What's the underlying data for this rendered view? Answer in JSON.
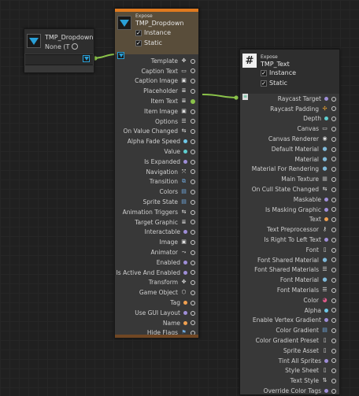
{
  "source_node": {
    "title": "TMP_Dropdown",
    "value": "None (T",
    "target_icon": "target-circle-icon"
  },
  "dropdown_node": {
    "expose_label": "Expose",
    "title": "TMP_Dropdown",
    "instance_label": "Instance",
    "static_label": "Static",
    "accent_color": "#e07a1f",
    "ports": [
      {
        "label": "Template",
        "icon": "move-icon"
      },
      {
        "label": "Caption Text",
        "icon": "text-box-icon"
      },
      {
        "label": "Caption Image",
        "icon": "image-icon"
      },
      {
        "label": "Placeholder",
        "icon": "script-icon"
      },
      {
        "label": "Item Text",
        "icon": "script-icon"
      },
      {
        "label": "Item Image",
        "icon": "image-icon"
      },
      {
        "label": "Options",
        "icon": "list-icon"
      },
      {
        "label": "On Value Changed",
        "icon": "event-icon"
      },
      {
        "label": "Alpha Fade Speed",
        "icon": "float-dot"
      },
      {
        "label": "Value",
        "icon": "int-dot"
      },
      {
        "label": "Is Expanded",
        "icon": "bool-dot"
      },
      {
        "label": "Navigation",
        "icon": "navigation-icon"
      },
      {
        "label": "Transition",
        "icon": "transition-icon"
      },
      {
        "label": "Colors",
        "icon": "colorblock-icon"
      },
      {
        "label": "Sprite State",
        "icon": "colorblock-icon"
      },
      {
        "label": "Animation Triggers",
        "icon": "event-icon"
      },
      {
        "label": "Target Graphic",
        "icon": "script-icon"
      },
      {
        "label": "Interactable",
        "icon": "bool-dot"
      },
      {
        "label": "Image",
        "icon": "image-icon"
      },
      {
        "label": "Animator",
        "icon": "animator-icon"
      },
      {
        "label": "Enabled",
        "icon": "bool-dot"
      },
      {
        "label": "Is Active And Enabled",
        "icon": "bool-dot"
      },
      {
        "label": "Transform",
        "icon": "transform-icon"
      },
      {
        "label": "Game Object",
        "icon": "cube-icon"
      },
      {
        "label": "Tag",
        "icon": "string-dot"
      },
      {
        "label": "Use GUI Layout",
        "icon": "bool-dot"
      },
      {
        "label": "Name",
        "icon": "string-dot"
      },
      {
        "label": "Hide Flags",
        "icon": "flags-icon"
      }
    ]
  },
  "text_node": {
    "expose_label": "Expose",
    "title": "TMP_Text",
    "instance_label": "Instance",
    "static_label": "Static",
    "ports": [
      {
        "label": "Raycast Target",
        "icon": "bool-dot"
      },
      {
        "label": "Raycast Padding",
        "icon": "vector-icon"
      },
      {
        "label": "Depth",
        "icon": "int-dot"
      },
      {
        "label": "Canvas",
        "icon": "canvas-icon"
      },
      {
        "label": "Canvas Renderer",
        "icon": "eye-icon"
      },
      {
        "label": "Default Material",
        "icon": "sphere-icon"
      },
      {
        "label": "Material",
        "icon": "sphere-icon"
      },
      {
        "label": "Material For Rendering",
        "icon": "sphere-icon"
      },
      {
        "label": "Main Texture",
        "icon": "texture-icon"
      },
      {
        "label": "On Cull State Changed",
        "icon": "event-icon"
      },
      {
        "label": "Maskable",
        "icon": "bool-dot"
      },
      {
        "label": "Is Masking Graphic",
        "icon": "bool-dot"
      },
      {
        "label": "Text",
        "icon": "string-dot"
      },
      {
        "label": "Text Preprocessor",
        "icon": "key-icon"
      },
      {
        "label": "Is Right To Left Text",
        "icon": "bool-dot"
      },
      {
        "label": "Font",
        "icon": "file-icon"
      },
      {
        "label": "Font Shared Material",
        "icon": "sphere-icon"
      },
      {
        "label": "Font Shared Materials",
        "icon": "list-icon"
      },
      {
        "label": "Font Material",
        "icon": "sphere-icon"
      },
      {
        "label": "Font Materials",
        "icon": "list-icon"
      },
      {
        "label": "Color",
        "icon": "color-icon"
      },
      {
        "label": "Alpha",
        "icon": "float-dot"
      },
      {
        "label": "Enable Vertex Gradient",
        "icon": "bool-dot"
      },
      {
        "label": "Color Gradient",
        "icon": "colorblock-icon"
      },
      {
        "label": "Color Gradient Preset",
        "icon": "file-icon"
      },
      {
        "label": "Sprite Asset",
        "icon": "file-icon"
      },
      {
        "label": "Tint All Sprites",
        "icon": "bool-dot"
      },
      {
        "label": "Style Sheet",
        "icon": "file-icon"
      },
      {
        "label": "Text Style",
        "icon": "arrows-icon"
      },
      {
        "label": "Override Color Tags",
        "icon": "bool-dot"
      }
    ]
  },
  "colors": {
    "bool": "#9f8ed8",
    "float": "#6fc8e8",
    "int": "#5fd0d0",
    "string": "#f0a050",
    "wire": "#8bc34a"
  }
}
